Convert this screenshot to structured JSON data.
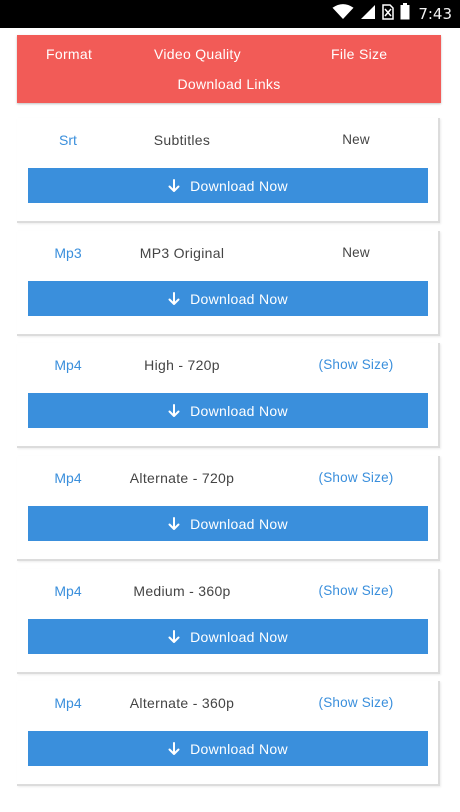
{
  "status_bar": {
    "time": "7:43",
    "icons": [
      "wifi-icon",
      "signal-icon",
      "no-sim-icon",
      "battery-icon"
    ]
  },
  "table_header": {
    "format": "Format",
    "video_quality": "Video Quality",
    "file_size": "File Size",
    "download_links": "Download Links"
  },
  "colors": {
    "header_bg": "#f25b57",
    "button_bg": "#3a8fdc",
    "link": "#3a8fdc"
  },
  "rows": [
    {
      "format": "Srt",
      "quality": "Subtitles",
      "size": "New",
      "button": "Download Now"
    },
    {
      "format": "Mp3",
      "quality": "MP3 Original",
      "size": "New",
      "button": "Download Now"
    },
    {
      "format": "Mp4",
      "quality": "High - 720p",
      "size": "(Show Size)",
      "button": "Download Now"
    },
    {
      "format": "Mp4",
      "quality": "Alternate - 720p",
      "size": "(Show Size)",
      "button": "Download Now"
    },
    {
      "format": "Mp4",
      "quality": "Medium - 360p",
      "size": "(Show Size)",
      "button": "Download Now"
    },
    {
      "format": "Mp4",
      "quality": "Alternate - 360p",
      "size": "(Show Size)",
      "button": "Download Now"
    }
  ]
}
